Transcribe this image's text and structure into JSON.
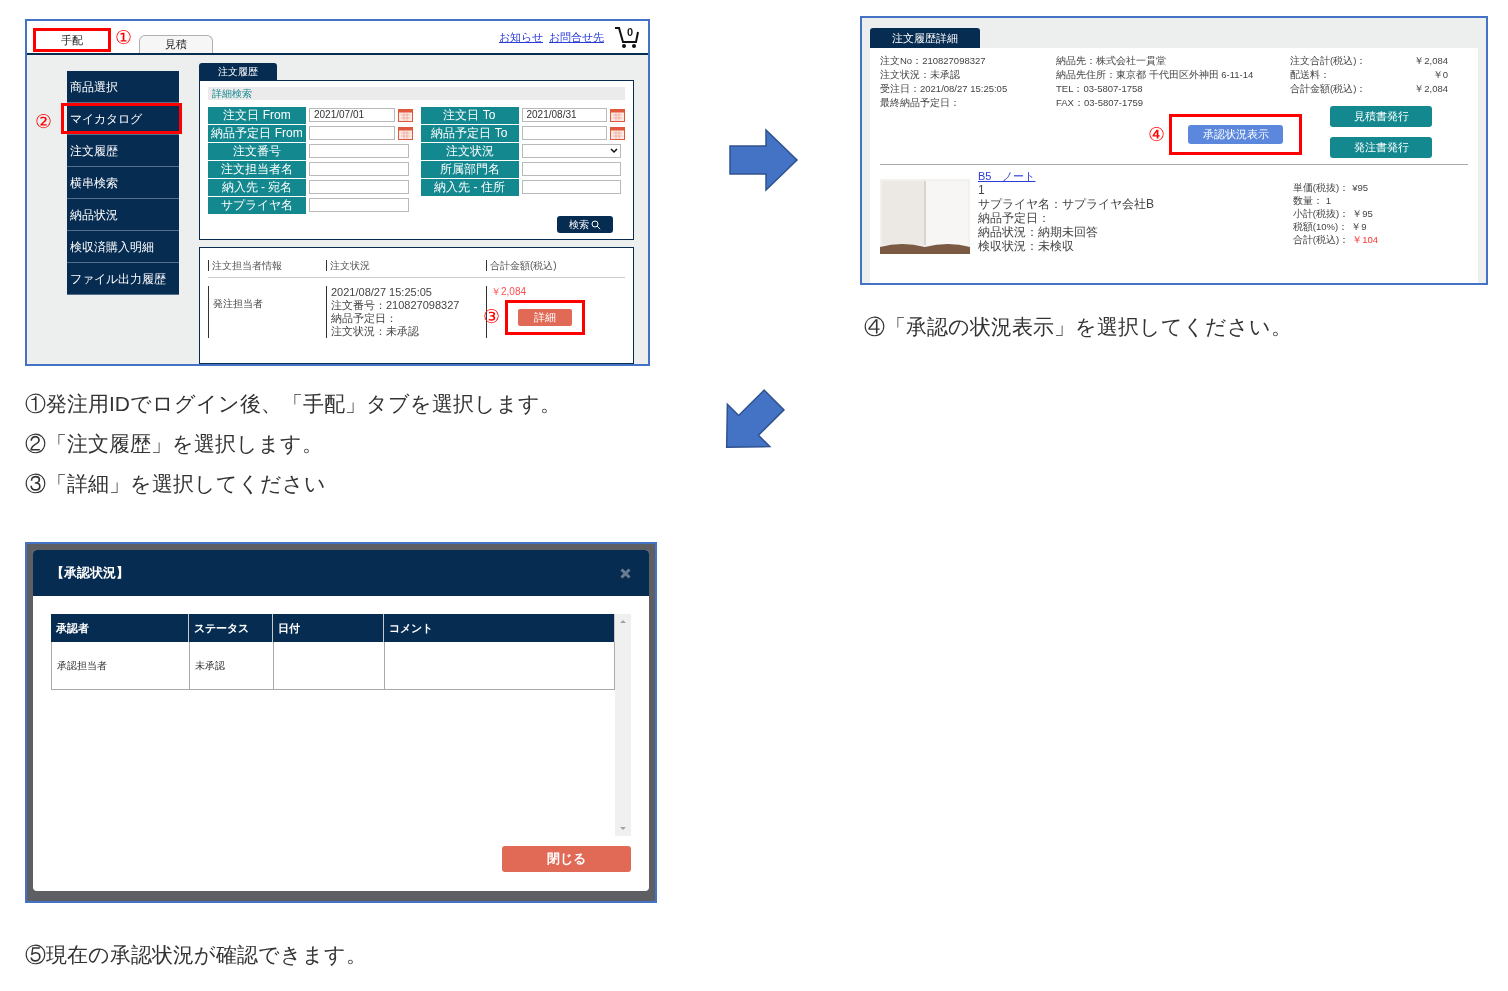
{
  "order_search_screen": {
    "tabs": [
      {
        "label": "手配",
        "selected": true,
        "highlighted": true,
        "callout": "①"
      },
      {
        "label": "見積",
        "selected": false,
        "highlighted": false
      }
    ],
    "header_links": [
      "お知らせ",
      "お問合せ先"
    ],
    "cart_count": "0",
    "sidebar": [
      {
        "label": "商品選択",
        "highlighted": false
      },
      {
        "label": "マイカタログ",
        "highlighted": true,
        "callout": "②"
      },
      {
        "label": "注文履歴",
        "highlighted": false
      },
      {
        "label": "横串検索",
        "highlighted": false
      },
      {
        "label": "納品状況",
        "highlighted": false
      },
      {
        "label": "検収済購入明細",
        "highlighted": false
      },
      {
        "label": "ファイル出力履歴",
        "highlighted": false
      }
    ],
    "page_tab": "注文履歴",
    "search": {
      "title": "詳細検索",
      "fields_left": [
        {
          "label": "注文日 From",
          "kind": "date",
          "value": "2021/07/01"
        },
        {
          "label": "納品予定日 From",
          "kind": "date"
        },
        {
          "label": "注文番号",
          "kind": "text"
        },
        {
          "label": "注文担当者名",
          "kind": "text"
        },
        {
          "label": "納入先 - 宛名",
          "kind": "text"
        },
        {
          "label": "サプライヤ名",
          "kind": "text"
        }
      ],
      "fields_right": [
        {
          "label": "注文日 To",
          "kind": "date",
          "value": "2021/08/31"
        },
        {
          "label": "納品予定日 To",
          "kind": "date"
        },
        {
          "label": "注文状況",
          "kind": "select"
        },
        {
          "label": "所属部門名",
          "kind": "text"
        },
        {
          "label": "納入先 - 住所",
          "kind": "text"
        }
      ],
      "button": "検索"
    },
    "results": {
      "columns": [
        "注文担当者情報",
        "注文状況",
        "合計金額(税込)"
      ],
      "rows": [
        {
          "person": "発注担当者",
          "status_lines": [
            "2021/08/27 15:25:05",
            "注文番号：210827098327",
            "納品予定日：",
            "注文状況：未承認"
          ],
          "total": "￥2,084",
          "button": "詳細",
          "highlighted": true,
          "callout": "③"
        }
      ]
    }
  },
  "steps_1_to_3": [
    "①発注用IDでログイン後、「手配」タブを選択します。",
    "②「注文履歴」を選択します。",
    "③「詳細」を選択してください"
  ],
  "order_detail_screen": {
    "tab": "注文履歴詳細",
    "info_left": [
      "注文No：210827098327",
      "注文状況：未承認",
      "受注日：2021/08/27 15:25:05",
      "最終納品予定日："
    ],
    "info_middle": [
      "納品先：株式会社一貫堂",
      "納品先住所：東京都 千代田区外神田 6-11-14",
      "TEL：03-5807-1758",
      "FAX：03-5807-1759"
    ],
    "totals": [
      {
        "label": "注文合計(税込)：",
        "value": "￥2,084"
      },
      {
        "label": "配送料：",
        "value": "￥0"
      },
      {
        "label": "合計金額(税込)：",
        "value": "￥2,084"
      }
    ],
    "approval_button": {
      "label": "承認状況表示",
      "highlighted": true,
      "callout": "④"
    },
    "document_buttons": [
      "見積書発行",
      "発注書発行"
    ],
    "item": {
      "name": "B5　ノート",
      "lines": [
        "1",
        "サプライヤ名：サプライヤ会社B",
        "納品予定日：",
        "納品状況：納期未回答",
        "検収状況：未検収"
      ],
      "prices": [
        {
          "label": "単価(税抜)：",
          "value": "¥95",
          "emphasis": false
        },
        {
          "label": "数量：",
          "value": "1",
          "emphasis": false
        },
        {
          "label": "小計(税抜)：",
          "value": "￥95",
          "emphasis": false
        },
        {
          "label": "税額(10%)：",
          "value": "￥9",
          "emphasis": false
        },
        {
          "label": "合計(税込)：",
          "value": "￥104",
          "emphasis": true
        }
      ]
    }
  },
  "step_4": "④「承認の状況表示」を選択してください。",
  "approval_dialog": {
    "title": "【承認状況】",
    "columns": [
      "承認者",
      "ステータス",
      "日付",
      "コメント"
    ],
    "rows": [
      {
        "cells": [
          "承認担当者",
          "未承認"
        ]
      }
    ],
    "close_button": "閉じる"
  },
  "step_5": "⑤現在の承認状況が確認できます。"
}
